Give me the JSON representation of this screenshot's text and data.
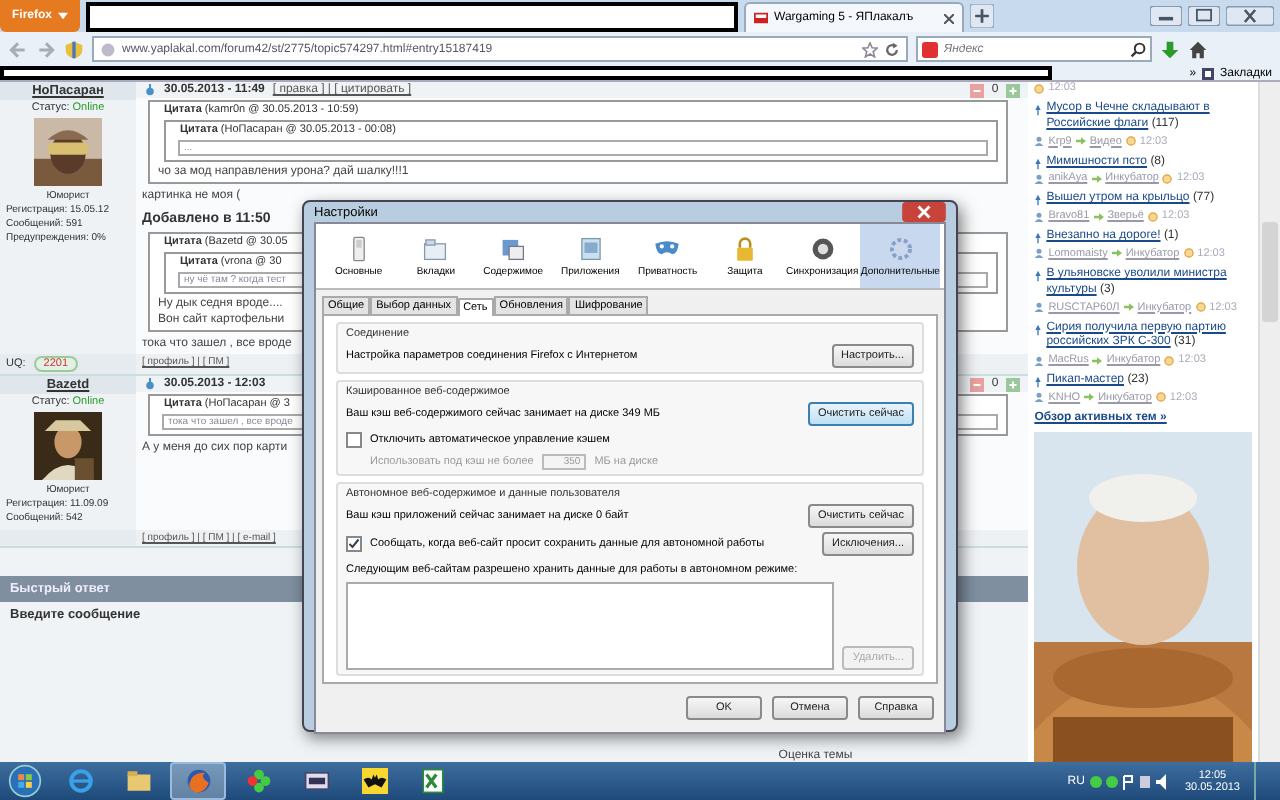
{
  "browser": {
    "menu_button": "Firefox",
    "tabs": [
      {
        "title": "Wargaming 5 - ЯПлакалъ",
        "selected": true
      }
    ],
    "address": "www.yaplakal.com/forum42/st/2775/topic574297.html#entry15187419",
    "search_placeholder": "Яндекс",
    "overflow": "»",
    "bookmarks_label": "Закладки"
  },
  "posts": [
    {
      "user": "НоПасаран",
      "date": "30.05.2013 - 11:49",
      "actions": "[ правка ] | [ цитировать ]",
      "rating": "0",
      "status_label": "Статус:",
      "status": "Online",
      "rank": "Юморист",
      "info": [
        "Регистрация: 15.05.12",
        "Сообщений: 591",
        "Предупреждения: 0%"
      ],
      "blocks": [
        {
          "kind": "quote",
          "header": "**Цитата** (kamr0n @ 30.05.2013 - 10:59)",
          "children": [
            {
              "kind": "quote",
              "header": "**Цитата** (НоПасаран @ 30.05.2013 - 00:08)",
              "children": [
                {
                  "kind": "field",
                  "text": "..."
                }
              ]
            },
            {
              "kind": "text",
              "text": "чо за мод направления урона? дай шалку!!!1"
            }
          ]
        },
        {
          "kind": "text",
          "text": "картинка не моя ("
        },
        {
          "kind": "heading",
          "text": "Добавлено в 11:50"
        },
        {
          "kind": "quote",
          "header": "**Цитата** (Bazetd @ 30.05",
          "children": [
            {
              "kind": "quote",
              "header": "**Цитата** (vrona @ 30",
              "children": [
                {
                  "kind": "field",
                  "text": "ну чё там ? когда тест"
                }
              ]
            },
            {
              "kind": "text",
              "text": "Ну дык седня вроде...."
            },
            {
              "kind": "text",
              "text": "Вон сайт картофельни"
            }
          ]
        },
        {
          "kind": "text",
          "text": "тока что зашел , все вроде"
        }
      ],
      "uq_label": "UQ:",
      "uq": "2201",
      "links": "[ профиль ] | [ ПМ ]"
    },
    {
      "user": "Bazetd",
      "date": "30.05.2013 - 12:03",
      "rating": "0",
      "status_label": "Статус:",
      "status": "Online",
      "rank": "Юморист",
      "info": [
        "Регистрация: 11.09.09",
        "Сообщений: 542"
      ],
      "blocks": [
        {
          "kind": "quote",
          "header": "**Цитата** (НоПасаран @ 3",
          "children": [
            {
              "kind": "field",
              "text": "тока что зашел , все вроде"
            }
          ]
        },
        {
          "kind": "text",
          "text": "А у меня до сих пор карти"
        }
      ],
      "links": "[ профиль ] | [ ПМ ] | [ e-mail ]"
    }
  ],
  "quick_reply": {
    "title": "Быстрый ответ",
    "label": "Введите сообщение",
    "rating_label": "Оценка темы"
  },
  "sidebar": {
    "top_time": "12:03",
    "topics": [
      {
        "title": "Мусор в Чечне складывают в Российские флаги",
        "count": "(117)",
        "author": "Krp9",
        "section": "Видео",
        "time": "12:03"
      },
      {
        "title": "Мимишности псто",
        "count": "(8)",
        "author": "anikAya",
        "section": "Инкубатор",
        "time": "12:03"
      },
      {
        "title": "Вышел утром на крыльцо",
        "count": "(77)",
        "author": "Bravo81",
        "section": "Зверьё",
        "time": "12:03"
      },
      {
        "title": "Внезапно на дороге!",
        "count": "(1)",
        "author": "Lomomaisty",
        "section": "Инкубатор",
        "time": "12:03"
      },
      {
        "title": "В ульяновске уволили министра культуры",
        "count": "(3)",
        "author": "RUSCTAP60Л",
        "section": "Инкубатор",
        "time": "12:03"
      },
      {
        "title": "Сирия получила первую партию российских ЗРК С-300",
        "count": "(31)",
        "author": "MacRus",
        "section": "Инкубатор",
        "time": "12:03"
      },
      {
        "title": "Пикап-мастер",
        "count": "(23)",
        "author": "KNHO",
        "section": "Инкубатор",
        "time": "12:03"
      }
    ],
    "more_link": "Обзор активных тем »"
  },
  "dialog": {
    "title": "Настройки",
    "panes": [
      {
        "label": "Основные",
        "selected": false
      },
      {
        "label": "Вкладки",
        "selected": false
      },
      {
        "label": "Содержимое",
        "selected": false
      },
      {
        "label": "Приложения",
        "selected": false
      },
      {
        "label": "Приватность",
        "selected": false
      },
      {
        "label": "Защита",
        "selected": false
      },
      {
        "label": "Синхронизация",
        "selected": false
      },
      {
        "label": "Дополнительные",
        "selected": true
      }
    ],
    "subtabs": [
      {
        "label": "Общие",
        "selected": false
      },
      {
        "label": "Выбор данных",
        "selected": false
      },
      {
        "label": "Сеть",
        "selected": true
      },
      {
        "label": "Обновления",
        "selected": false
      },
      {
        "label": "Шифрование",
        "selected": false
      }
    ],
    "groups": [
      {
        "title": "Соединение",
        "rows": [
          {
            "kind": "text_button",
            "text": "Настройка параметров соединения Firefox с Интернетом",
            "button": "Настроить...",
            "focused": false
          }
        ]
      },
      {
        "title": "Кэшированное веб-содержимое",
        "rows": [
          {
            "kind": "text_button",
            "text": "Ваш кэш веб-содержимого сейчас занимает на диске 349 МБ",
            "button": "Очистить сейчас",
            "focused": true
          },
          {
            "kind": "checkbox",
            "label": "Отключить автоматическое управление кэшем",
            "checked": false
          },
          {
            "kind": "spin",
            "label": "Использовать под кэш не более",
            "value": "350",
            "unit": "МБ на диске",
            "disabled": true
          }
        ]
      },
      {
        "title": "Автономное веб-содержимое и данные пользователя",
        "rows": [
          {
            "kind": "text_button",
            "text": "Ваш кэш приложений сейчас занимает на диске 0 байт",
            "button": "Очистить сейчас",
            "focused": false
          },
          {
            "kind": "checkbox_button",
            "label": "Сообщать, когда веб-сайт просит сохранить данные для автономной работы",
            "checked": true,
            "button": "Исключения..."
          },
          {
            "kind": "label",
            "text": "Следующим веб-сайтам разрешено хранить данные для работы в автономном режиме:"
          },
          {
            "kind": "list",
            "button": "Удалить...",
            "disabled": true
          }
        ]
      }
    ],
    "buttons": [
      "OK",
      "Отмена",
      "Справка"
    ]
  },
  "taskbar": {
    "apps": [
      {
        "active": false
      },
      {
        "active": false
      },
      {
        "active": true
      },
      {
        "active": false
      },
      {
        "active": false
      },
      {
        "active": false
      },
      {
        "active": false
      }
    ],
    "language": "RU",
    "time": "12:05",
    "date": "30.05.2013"
  }
}
